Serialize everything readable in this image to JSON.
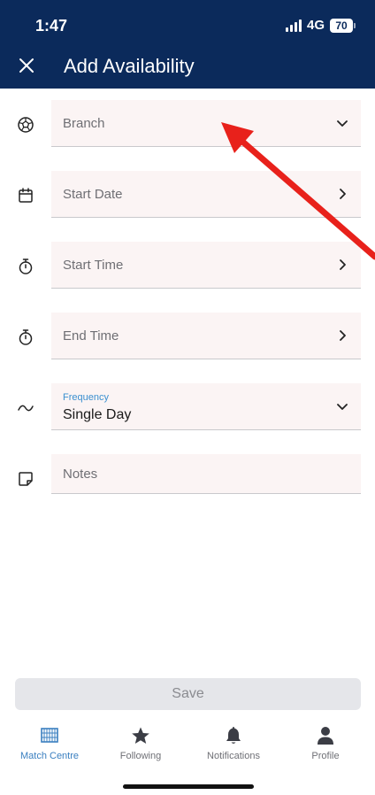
{
  "status_bar": {
    "time": "1:47",
    "network": "4G",
    "battery": "70"
  },
  "header": {
    "title": "Add Availability"
  },
  "fields": [
    {
      "placeholder": "Branch",
      "icon": "soccer-ball-icon",
      "control": "chevron-down-icon"
    },
    {
      "placeholder": "Start Date",
      "icon": "calendar-icon",
      "control": "chevron-right-icon"
    },
    {
      "placeholder": "Start Time",
      "icon": "stopwatch-icon",
      "control": "chevron-right-icon"
    },
    {
      "placeholder": "End Time",
      "icon": "stopwatch-icon",
      "control": "chevron-right-icon"
    },
    {
      "label": "Frequency",
      "value": "Single Day",
      "icon": "wave-icon",
      "control": "chevron-down-icon"
    },
    {
      "placeholder": "Notes",
      "icon": "note-icon"
    }
  ],
  "save_label": "Save",
  "tabs": [
    {
      "label": "Match Centre",
      "icon": "grid-icon",
      "active": true
    },
    {
      "label": "Following",
      "icon": "star-icon",
      "active": false
    },
    {
      "label": "Notifications",
      "icon": "bell-icon",
      "active": false
    },
    {
      "label": "Profile",
      "icon": "person-icon",
      "active": false
    }
  ],
  "colors": {
    "header": "#0b2a5b",
    "field_bg": "#fbf4f4",
    "accent": "#3a8fd0",
    "annotation_arrow": "#e8211b"
  }
}
